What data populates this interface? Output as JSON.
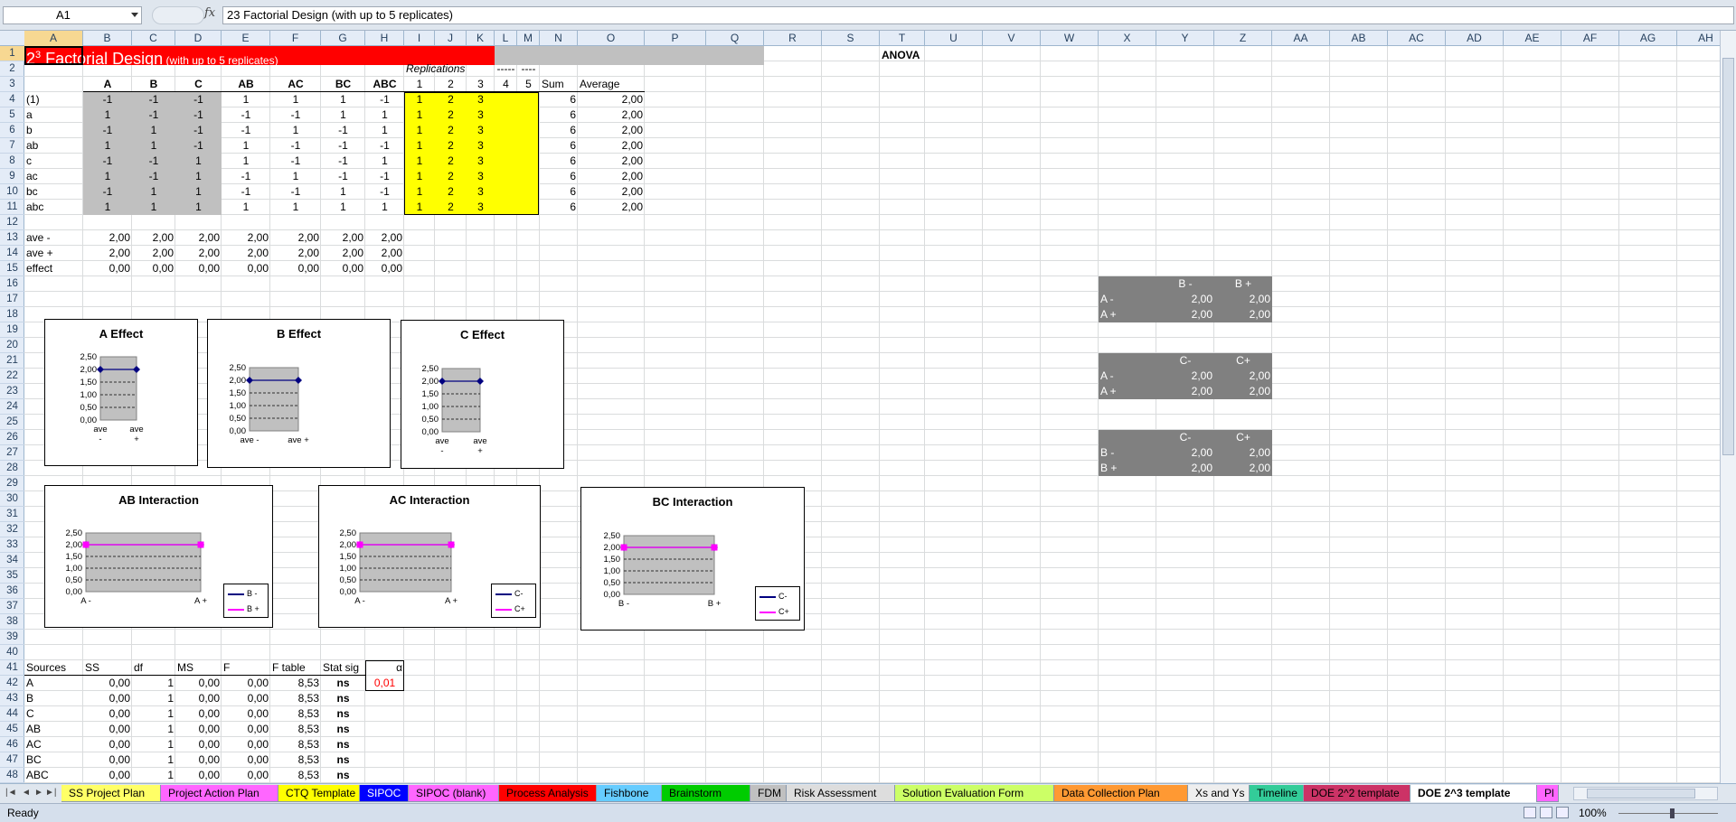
{
  "formula_bar": {
    "name_box": "A1",
    "fx": "fx",
    "formula": "23 Factorial Design (with up to 5 replicates)"
  },
  "columns": [
    "A",
    "B",
    "C",
    "D",
    "E",
    "F",
    "G",
    "H",
    "I",
    "J",
    "K",
    "L",
    "M",
    "N",
    "O",
    "P",
    "Q",
    "R",
    "S",
    "T",
    "U",
    "V",
    "W",
    "X",
    "Y",
    "Z",
    "AA",
    "AB",
    "AC",
    "AD",
    "AE",
    "AF",
    "AG",
    "AH"
  ],
  "rows": [
    "1",
    "2",
    "3",
    "4",
    "5",
    "6",
    "7",
    "8",
    "9",
    "10",
    "11",
    "12",
    "13",
    "14",
    "15",
    "16",
    "17",
    "18",
    "19",
    "20",
    "21",
    "22",
    "23",
    "24",
    "25",
    "26",
    "27",
    "28",
    "29",
    "30",
    "31",
    "32",
    "33",
    "34",
    "35",
    "36",
    "37",
    "38",
    "39",
    "40",
    "41",
    "42",
    "43",
    "44",
    "45",
    "46",
    "47",
    "48"
  ],
  "sheet": {
    "title_main": "2",
    "title_sup": "3",
    "title_rest": " Factorial Design",
    "title_small": "(with up to 5 replicates)",
    "anova": "ANOVA",
    "replications_label": "Replications",
    "dashes1": "-----",
    "dashes2": "----",
    "header_row": [
      "A",
      "B",
      "C",
      "AB",
      "AC",
      "BC",
      "ABC",
      "1",
      "2",
      "3",
      "4",
      "5",
      "Sum",
      "Average"
    ],
    "design": [
      {
        "label": "(1)",
        "vals": [
          "-1",
          "-1",
          "-1",
          "1",
          "1",
          "1",
          "-1"
        ],
        "reps": [
          "1",
          "2",
          "3"
        ],
        "sum": "6",
        "avg": "2,00"
      },
      {
        "label": "a",
        "vals": [
          "1",
          "-1",
          "-1",
          "-1",
          "-1",
          "1",
          "1"
        ],
        "reps": [
          "1",
          "2",
          "3"
        ],
        "sum": "6",
        "avg": "2,00"
      },
      {
        "label": "b",
        "vals": [
          "-1",
          "1",
          "-1",
          "-1",
          "1",
          "-1",
          "1"
        ],
        "reps": [
          "1",
          "2",
          "3"
        ],
        "sum": "6",
        "avg": "2,00"
      },
      {
        "label": "ab",
        "vals": [
          "1",
          "1",
          "-1",
          "1",
          "-1",
          "-1",
          "-1"
        ],
        "reps": [
          "1",
          "2",
          "3"
        ],
        "sum": "6",
        "avg": "2,00"
      },
      {
        "label": "c",
        "vals": [
          "-1",
          "-1",
          "1",
          "1",
          "-1",
          "-1",
          "1"
        ],
        "reps": [
          "1",
          "2",
          "3"
        ],
        "sum": "6",
        "avg": "2,00"
      },
      {
        "label": "ac",
        "vals": [
          "1",
          "-1",
          "1",
          "-1",
          "1",
          "-1",
          "-1"
        ],
        "reps": [
          "1",
          "2",
          "3"
        ],
        "sum": "6",
        "avg": "2,00"
      },
      {
        "label": "bc",
        "vals": [
          "-1",
          "1",
          "1",
          "-1",
          "-1",
          "1",
          "-1"
        ],
        "reps": [
          "1",
          "2",
          "3"
        ],
        "sum": "6",
        "avg": "2,00"
      },
      {
        "label": "abc",
        "vals": [
          "1",
          "1",
          "1",
          "1",
          "1",
          "1",
          "1"
        ],
        "reps": [
          "1",
          "2",
          "3"
        ],
        "sum": "6",
        "avg": "2,00"
      }
    ],
    "effects": [
      {
        "label": "ave -",
        "vals": [
          "2,00",
          "2,00",
          "2,00",
          "2,00",
          "2,00",
          "2,00",
          "2,00"
        ]
      },
      {
        "label": "ave +",
        "vals": [
          "2,00",
          "2,00",
          "2,00",
          "2,00",
          "2,00",
          "2,00",
          "2,00"
        ]
      },
      {
        "label": "effect",
        "vals": [
          "0,00",
          "0,00",
          "0,00",
          "0,00",
          "0,00",
          "0,00",
          "0,00"
        ]
      }
    ],
    "interaction_tables": [
      {
        "col1": "B -",
        "col2": "B +",
        "rows": [
          {
            "label": "A -",
            "v1": "2,00",
            "v2": "2,00"
          },
          {
            "label": "A +",
            "v1": "2,00",
            "v2": "2,00"
          }
        ]
      },
      {
        "col1": "C-",
        "col2": "C+",
        "rows": [
          {
            "label": "A -",
            "v1": "2,00",
            "v2": "2,00"
          },
          {
            "label": "A +",
            "v1": "2,00",
            "v2": "2,00"
          }
        ]
      },
      {
        "col1": "C-",
        "col2": "C+",
        "rows": [
          {
            "label": "B -",
            "v1": "2,00",
            "v2": "2,00"
          },
          {
            "label": "B +",
            "v1": "2,00",
            "v2": "2,00"
          }
        ]
      }
    ],
    "anova_headers": [
      "Sources",
      "SS",
      "df",
      "MS",
      "F",
      "F table",
      "Stat sig"
    ],
    "alpha_label": "α",
    "alpha_value": "0,01",
    "anova_rows": [
      {
        "src": "A",
        "ss": "0,00",
        "df": "1",
        "ms": "0,00",
        "f": "0,00",
        "ft": "8,53",
        "sig": "ns"
      },
      {
        "src": "B",
        "ss": "0,00",
        "df": "1",
        "ms": "0,00",
        "f": "0,00",
        "ft": "8,53",
        "sig": "ns"
      },
      {
        "src": "C",
        "ss": "0,00",
        "df": "1",
        "ms": "0,00",
        "f": "0,00",
        "ft": "8,53",
        "sig": "ns"
      },
      {
        "src": "AB",
        "ss": "0,00",
        "df": "1",
        "ms": "0,00",
        "f": "0,00",
        "ft": "8,53",
        "sig": "ns"
      },
      {
        "src": "AC",
        "ss": "0,00",
        "df": "1",
        "ms": "0,00",
        "f": "0,00",
        "ft": "8,53",
        "sig": "ns"
      },
      {
        "src": "BC",
        "ss": "0,00",
        "df": "1",
        "ms": "0,00",
        "f": "0,00",
        "ft": "8,53",
        "sig": "ns"
      },
      {
        "src": "ABC",
        "ss": "0,00",
        "df": "1",
        "ms": "0,00",
        "f": "0,00",
        "ft": "8,53",
        "sig": "ns"
      }
    ]
  },
  "chart_data": [
    {
      "type": "line",
      "title": "A Effect",
      "categories": [
        "ave -",
        "ave +"
      ],
      "series": [
        {
          "values": [
            2.0,
            2.0
          ]
        }
      ],
      "ylim": [
        0,
        2.5
      ],
      "yticks": [
        "2,50",
        "2,00",
        "1,50",
        "1,00",
        "0,50",
        "0,00"
      ],
      "color": "#000080",
      "plot_bg": "#c0c0c0"
    },
    {
      "type": "line",
      "title": "B Effect",
      "categories": [
        "ave -",
        "ave +"
      ],
      "series": [
        {
          "values": [
            2.0,
            2.0
          ]
        }
      ],
      "ylim": [
        0,
        2.5
      ],
      "yticks": [
        "2,50",
        "2,00",
        "1,50",
        "1,00",
        "0,50",
        "0,00"
      ],
      "color": "#000080",
      "plot_bg": "#c0c0c0"
    },
    {
      "type": "line",
      "title": "C Effect",
      "categories": [
        "ave -",
        "ave +"
      ],
      "series": [
        {
          "values": [
            2.0,
            2.0
          ]
        }
      ],
      "ylim": [
        0,
        2.5
      ],
      "yticks": [
        "2,50",
        "2,00",
        "1,50",
        "1,00",
        "0,50",
        "0,00"
      ],
      "color": "#000080",
      "plot_bg": "#c0c0c0"
    },
    {
      "type": "line",
      "title": "AB Interaction",
      "categories": [
        "A -",
        "A +"
      ],
      "series": [
        {
          "name": "B -",
          "values": [
            2.0,
            2.0
          ],
          "color": "#000080"
        },
        {
          "name": "B +",
          "values": [
            2.0,
            2.0
          ],
          "color": "#ff00ff"
        }
      ],
      "ylim": [
        0,
        2.5
      ],
      "yticks": [
        "2,50",
        "2,00",
        "1,50",
        "1,00",
        "0,50",
        "0,00"
      ],
      "plot_bg": "#c0c0c0"
    },
    {
      "type": "line",
      "title": "AC Interaction",
      "categories": [
        "A -",
        "A +"
      ],
      "series": [
        {
          "name": "C-",
          "values": [
            2.0,
            2.0
          ],
          "color": "#000080"
        },
        {
          "name": "C+",
          "values": [
            2.0,
            2.0
          ],
          "color": "#ff00ff"
        }
      ],
      "ylim": [
        0,
        2.5
      ],
      "yticks": [
        "2,50",
        "2,00",
        "1,50",
        "1,00",
        "0,50",
        "0,00"
      ],
      "plot_bg": "#c0c0c0"
    },
    {
      "type": "line",
      "title": "BC Interaction",
      "categories": [
        "B -",
        "B +"
      ],
      "series": [
        {
          "name": "C-",
          "values": [
            2.0,
            2.0
          ],
          "color": "#000080"
        },
        {
          "name": "C+",
          "values": [
            2.0,
            2.0
          ],
          "color": "#ff00ff"
        }
      ],
      "ylim": [
        0,
        2.5
      ],
      "yticks": [
        "2,50",
        "2,00",
        "1,50",
        "1,00",
        "0,50",
        "0,00"
      ],
      "plot_bg": "#c0c0c0"
    }
  ],
  "tabs": [
    {
      "label": "SS Project Plan",
      "color": "#ffff66"
    },
    {
      "label": "Project Action Plan",
      "color": "#ff66ff"
    },
    {
      "label": "CTQ Template",
      "color": "#ffff00"
    },
    {
      "label": "SIPOC",
      "color": "#0000ff"
    },
    {
      "label": "SIPOC (blank)",
      "color": "#ff66ff"
    },
    {
      "label": "Process Analysis",
      "color": "#ff0000"
    },
    {
      "label": "Fishbone",
      "color": "#66ccff"
    },
    {
      "label": "Brainstorm",
      "color": "#00cc00"
    },
    {
      "label": "FDM",
      "color": "#c0c0c0"
    },
    {
      "label": "Risk Assessment",
      "color": "#dddddd"
    },
    {
      "label": "Solution Evaluation Form",
      "color": "#ccff66"
    },
    {
      "label": "Data Collection Plan",
      "color": "#ff9933"
    },
    {
      "label": "Xs and Ys",
      "color": "#eeeeee"
    },
    {
      "label": "Timeline",
      "color": "#33cc99"
    },
    {
      "label": "DOE 2^2 template",
      "color": "#cc3366"
    },
    {
      "label": "DOE 2^3 template",
      "color": "#ffffff",
      "active": true
    },
    {
      "label": "Pl",
      "color": "#ff66ff"
    }
  ],
  "status": {
    "ready": "Ready",
    "zoom": "100%"
  }
}
